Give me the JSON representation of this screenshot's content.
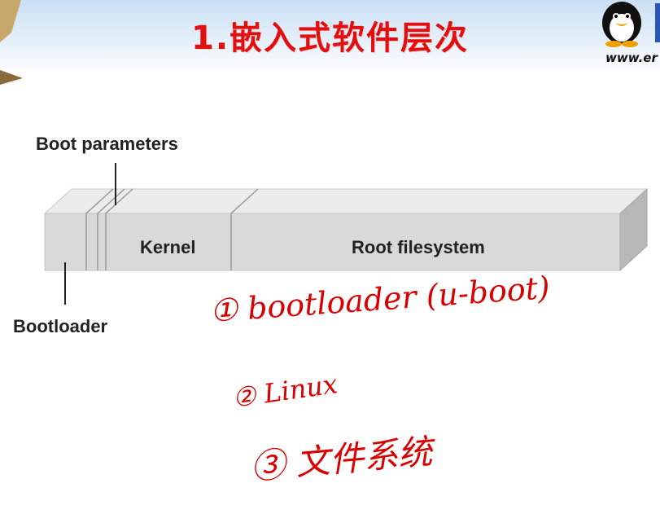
{
  "slide": {
    "title": "1.嵌入式软件层次",
    "url": "www.er"
  },
  "diagram": {
    "labels": {
      "boot_parameters": "Boot parameters",
      "kernel": "Kernel",
      "root_filesystem": "Root filesystem",
      "bootloader": "Bootloader"
    }
  },
  "annotations": [
    {
      "text": "① bootloader (u-boot)"
    },
    {
      "text": "② Linux"
    },
    {
      "text": "③ 文件系统"
    }
  ],
  "colors": {
    "title": "#e01010",
    "ink": "#d80000",
    "bar": "#d9d9d9"
  }
}
